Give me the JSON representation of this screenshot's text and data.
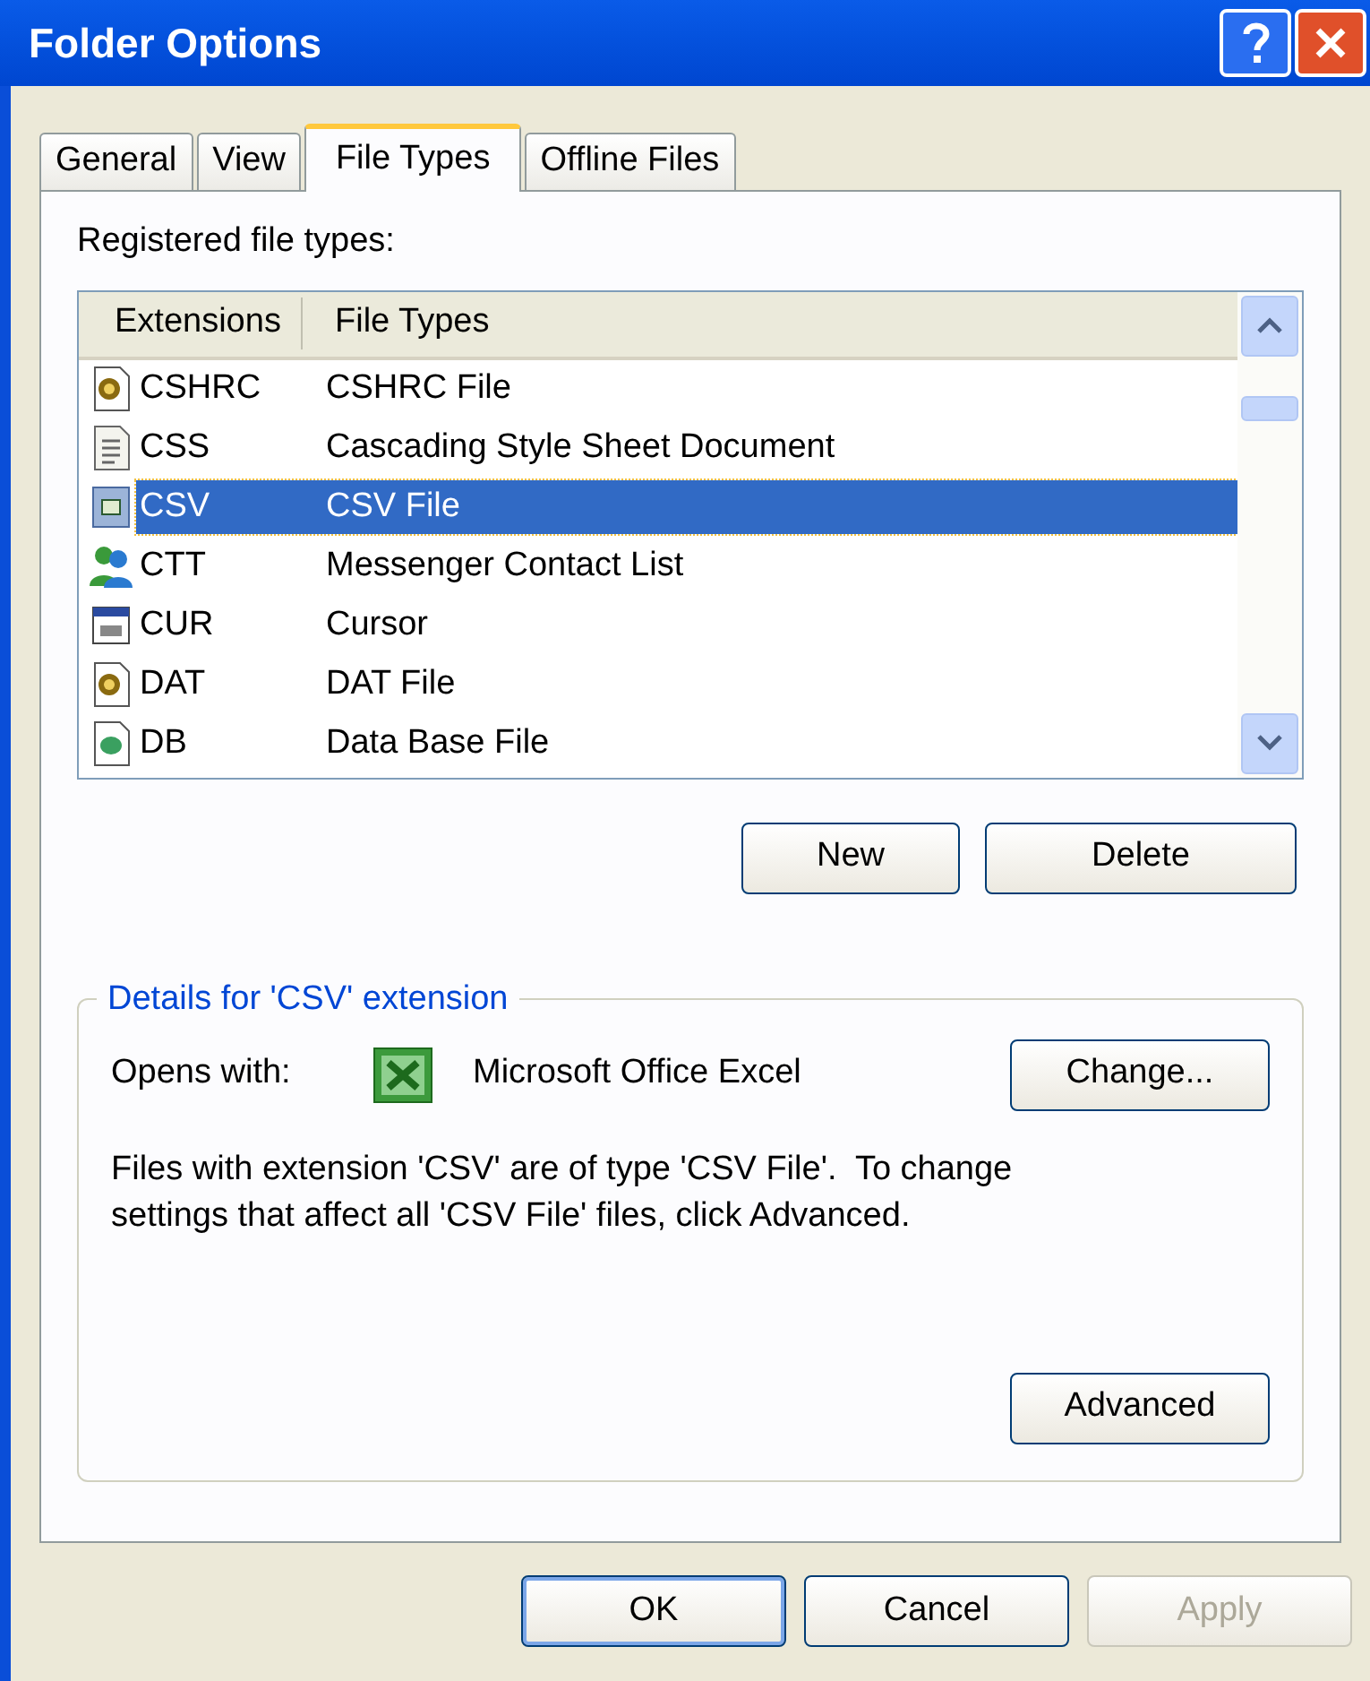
{
  "window": {
    "title": "Folder Options"
  },
  "tabs": [
    {
      "label": "General",
      "selected": false
    },
    {
      "label": "View",
      "selected": false
    },
    {
      "label": "File Types",
      "selected": true
    },
    {
      "label": "Offline Files",
      "selected": false
    }
  ],
  "registered_label": "Registered file types:",
  "list": {
    "columns": [
      "Extensions",
      "File Types"
    ],
    "rows": [
      {
        "kind": "script",
        "extension": "CSHRC",
        "file_type": "CSHRC File",
        "selected": false
      },
      {
        "kind": "text",
        "extension": "CSS",
        "file_type": "Cascading Style Sheet Document",
        "selected": false
      },
      {
        "kind": "sheet",
        "extension": "CSV",
        "file_type": "CSV File",
        "selected": true
      },
      {
        "kind": "contact",
        "extension": "CTT",
        "file_type": "Messenger Contact List",
        "selected": false
      },
      {
        "kind": "cursor",
        "extension": "CUR",
        "file_type": "Cursor",
        "selected": false
      },
      {
        "kind": "script",
        "extension": "DAT",
        "file_type": "DAT File",
        "selected": false
      },
      {
        "kind": "database",
        "extension": "DB",
        "file_type": "Data Base File",
        "selected": false
      }
    ]
  },
  "list_buttons": [
    "New",
    "Delete"
  ],
  "details": {
    "title": "Details for 'CSV' extension",
    "opens_with_label": "Opens with:",
    "program": "Microsoft Office Excel",
    "change_button": "Change...",
    "description": "Files with extension 'CSV' are of type 'CSV File'.  To change settings that affect all 'CSV File' files, click Advanced.",
    "advanced_button": "Advanced"
  },
  "footer_buttons": [
    {
      "label": "OK",
      "disabled": false,
      "default": true
    },
    {
      "label": "Cancel",
      "disabled": false,
      "default": false
    },
    {
      "label": "Apply",
      "disabled": true,
      "default": false
    }
  ]
}
